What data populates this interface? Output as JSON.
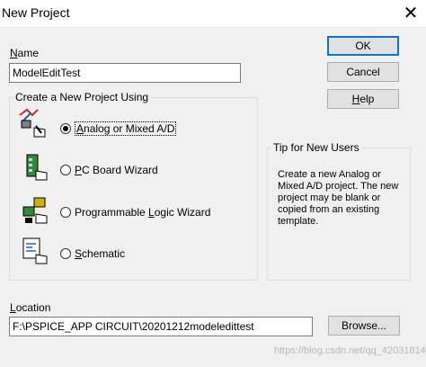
{
  "window": {
    "title": "New Project"
  },
  "name_label": {
    "mnemonic": "N",
    "rest": "ame"
  },
  "name_value": "ModelEditTest",
  "buttons": {
    "ok": "OK",
    "cancel": "Cancel",
    "help_mnemonic": "H",
    "help_rest": "elp"
  },
  "group": {
    "title": "Create a New Project Using"
  },
  "options": [
    {
      "mnemonic": "A",
      "rest": "nalog or Mixed A/D",
      "selected": true,
      "icon": "analog-probe-icon"
    },
    {
      "mnemonic": "P",
      "rest": "C Board Wizard",
      "selected": false,
      "icon": "pcb-board-icon"
    },
    {
      "prefix": "Programmable ",
      "mnemonic": "L",
      "rest": "ogic Wizard",
      "selected": false,
      "icon": "logic-chip-icon"
    },
    {
      "mnemonic": "S",
      "rest": "chematic",
      "selected": false,
      "icon": "schematic-sheet-icon"
    }
  ],
  "tip": {
    "title": "Tip for New Users",
    "text": "Create a new Analog or Mixed A/D project.  The new project may be blank or copied from an existing template."
  },
  "location_label": {
    "mnemonic": "L",
    "rest": "ocation"
  },
  "location_value": "F:\\PSPICE_APP CIRCUIT\\20201212modeledittest",
  "browse_label": "Browse...",
  "watermark": "https://blog.csdn.net/qq_42031814"
}
